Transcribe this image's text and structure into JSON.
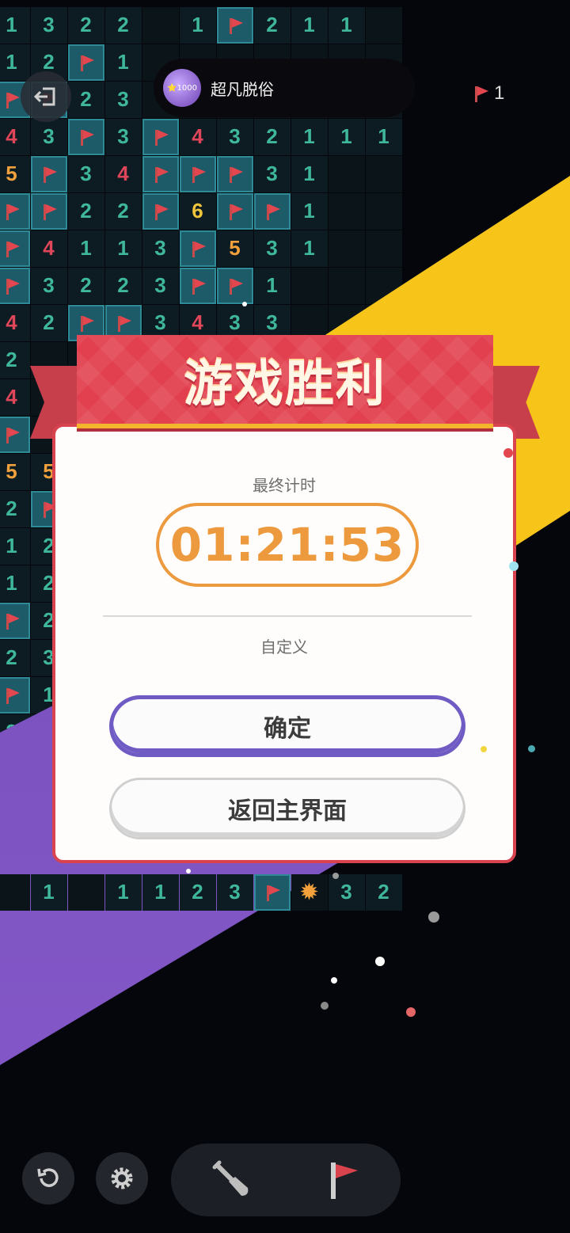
{
  "user": {
    "name": "超凡脱俗",
    "avatar_badge": "⭐1000"
  },
  "flags_remaining": "1",
  "dialog": {
    "title": "游戏胜利",
    "time_label": "最终计时",
    "time_value": "01:21:53",
    "mode_label": "自定义",
    "confirm_label": "确定",
    "home_label": "返回主界面"
  },
  "toolbar": {
    "icons": [
      "undo-icon",
      "gear-icon",
      "shovel-icon",
      "flag-icon"
    ]
  },
  "board_rows": [
    [
      "1",
      "3",
      "2",
      "2",
      "",
      "1",
      "F",
      "2",
      "1",
      "1",
      ""
    ],
    [
      "1",
      "2",
      "F",
      "1",
      "",
      "",
      "",
      "",
      "",
      "",
      ""
    ],
    [
      "F",
      "F",
      "2",
      "3",
      "",
      "",
      "",
      "",
      "",
      "",
      ""
    ],
    [
      "4",
      "3",
      "F",
      "3",
      "F",
      "4",
      "3",
      "2",
      "1",
      "1",
      "1"
    ],
    [
      "5",
      "F",
      "3",
      "4",
      "F",
      "F",
      "F",
      "3",
      "1",
      "",
      ""
    ],
    [
      "F",
      "F",
      "2",
      "2",
      "F",
      "6",
      "F",
      "F",
      "1",
      "",
      ""
    ],
    [
      "F",
      "4",
      "1",
      "1",
      "3",
      "F",
      "5",
      "3",
      "1",
      "",
      ""
    ],
    [
      "F",
      "3",
      "2",
      "2",
      "3",
      "F",
      "F",
      "1",
      "",
      "",
      ""
    ],
    [
      "4",
      "2",
      "F",
      "F",
      "3",
      "4",
      "3",
      "3",
      "",
      "",
      ""
    ],
    [
      "2",
      "",
      "",
      "",
      "",
      "",
      "",
      "",
      "",
      "",
      ""
    ],
    [
      "4",
      "",
      "",
      "",
      "",
      "",
      "",
      "",
      "",
      "",
      ""
    ],
    [
      "F",
      "",
      "",
      "",
      "",
      "",
      "",
      "",
      "",
      "",
      ""
    ],
    [
      "5",
      "5",
      "",
      "",
      "",
      "",
      "",
      "",
      "",
      "",
      ""
    ],
    [
      "2",
      "F",
      "",
      "",
      "",
      "",
      "",
      "",
      "",
      "",
      ""
    ],
    [
      "1",
      "2",
      "",
      "",
      "",
      "",
      "",
      "",
      "",
      "",
      ""
    ],
    [
      "1",
      "2",
      "",
      "",
      "",
      "",
      "",
      "",
      "",
      "",
      ""
    ],
    [
      "F",
      "2",
      "",
      "",
      "",
      "",
      "",
      "",
      "",
      "",
      ""
    ],
    [
      "2",
      "3",
      "",
      "",
      "",
      "",
      "",
      "",
      "",
      "",
      ""
    ],
    [
      "F",
      "1",
      "",
      "",
      "",
      "",
      "",
      "",
      "",
      "",
      ""
    ],
    [
      "2",
      "2",
      "",
      "",
      "",
      "",
      "",
      "",
      "",
      "",
      ""
    ]
  ],
  "board_bottom_row": [
    "",
    "1",
    "",
    "1",
    "1",
    "2",
    "3",
    "F",
    "*",
    "3",
    "2"
  ],
  "colors": {
    "accent_red": "#e2404f",
    "timer_orange": "#ec9a3d",
    "confirm_purple": "#6f5bc3",
    "band_yellow": "#f7c51a",
    "band_purple": "#7a52c1"
  }
}
